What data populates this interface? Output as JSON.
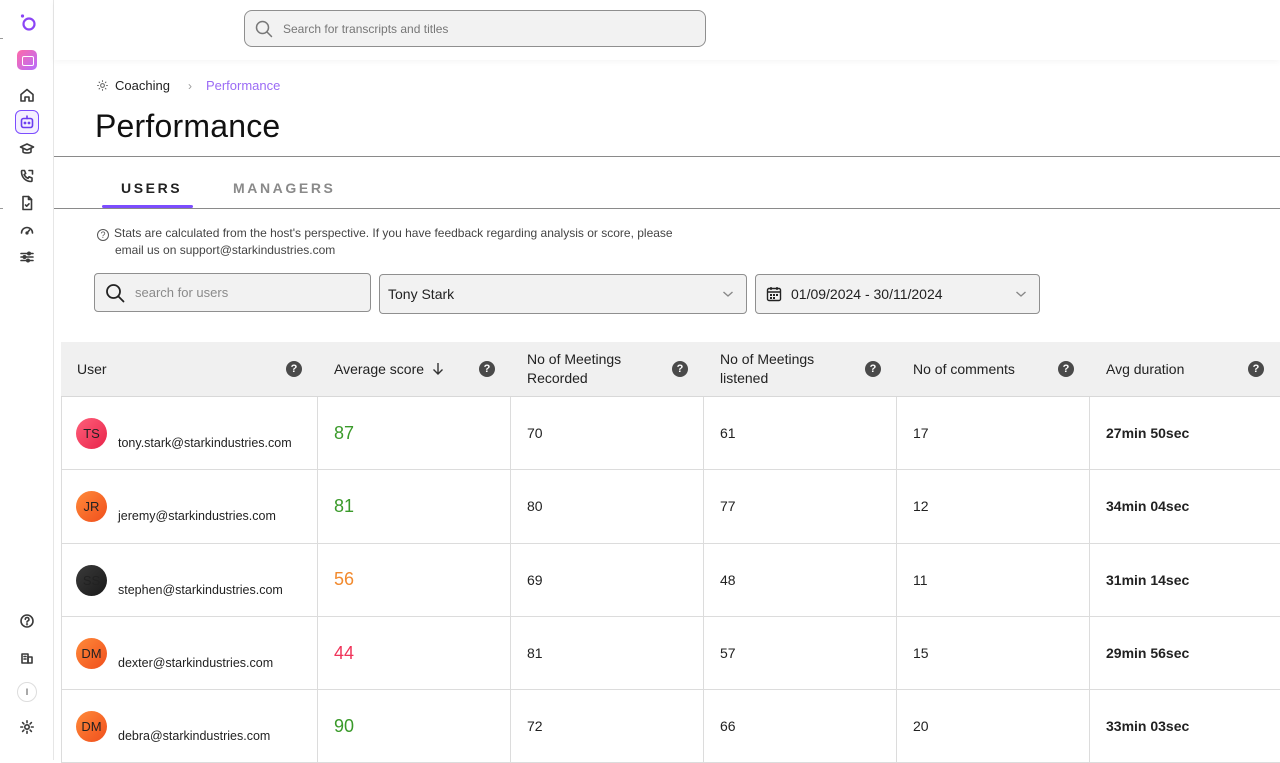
{
  "search": {
    "placeholder": "Search for transcripts and titles"
  },
  "breadcrumb": {
    "parent": "Coaching",
    "current": "Performance"
  },
  "page_title": "Performance",
  "tabs": [
    {
      "label": "USERS",
      "active": true
    },
    {
      "label": "MANAGERS",
      "active": false
    }
  ],
  "info": {
    "line1": "Stats are calculated from the host's perspective. If you have feedback regarding analysis or score, please",
    "line2": "email us on support@starkindustries.com"
  },
  "filters": {
    "user_search_placeholder": "search for users",
    "selected_user": "Tony Stark",
    "date_range": "01/09/2024 - 30/11/2024"
  },
  "table": {
    "headers": {
      "user": "User",
      "avg_score": "Average score",
      "meetings_recorded_1": "No of Meetings",
      "meetings_recorded_2": "Recorded",
      "meetings_listened_1": "No of Meetings",
      "meetings_listened_2": "listened",
      "comments": "No of comments",
      "avg_duration": "Avg duration"
    },
    "rows": [
      {
        "initials": "TS",
        "email": "tony.stark@starkindustries.com",
        "score": "87",
        "score_color": "#3a9a2a",
        "recorded": "70",
        "listened": "61",
        "comments": "17",
        "duration": "27min 50sec",
        "avatar": "linear-gradient(135deg,#ff5f7a,#e8244a)"
      },
      {
        "initials": "JR",
        "email": "jeremy@starkindustries.com",
        "score": "81",
        "score_color": "#3a9a2a",
        "recorded": "80",
        "listened": "77",
        "comments": "12",
        "duration": "34min 04sec",
        "avatar": "linear-gradient(135deg,#ff8a3a,#f04e1c)"
      },
      {
        "initials": "SS",
        "email": "stephen@starkindustries.com",
        "score": "56",
        "score_color": "#f28a2e",
        "recorded": "69",
        "listened": "48",
        "comments": "11",
        "duration": "31min 14sec",
        "avatar": "linear-gradient(135deg,#3a3a3a,#1a1a1a)"
      },
      {
        "initials": "DM",
        "email": "dexter@starkindustries.com",
        "score": "44",
        "score_color": "#f0345a",
        "recorded": "81",
        "listened": "57",
        "comments": "15",
        "duration": "29min 56sec",
        "avatar": "linear-gradient(135deg,#ff8a3a,#f04e1c)"
      },
      {
        "initials": "DM",
        "email": "debra@starkindustries.com",
        "score": "90",
        "score_color": "#3a9a2a",
        "recorded": "72",
        "listened": "66",
        "comments": "20",
        "duration": "33min 03sec",
        "avatar": "linear-gradient(135deg,#ff8a3a,#f04e1c)"
      }
    ]
  },
  "sidebar": {
    "icons": [
      "logo-icon",
      "app-icon",
      "home-icon",
      "coaching-icon",
      "learning-icon",
      "calls-icon",
      "documents-icon",
      "analytics-icon",
      "settings-sliders-icon",
      "help-icon",
      "company-icon",
      "user-icon",
      "gear-icon"
    ],
    "user_initial": "I"
  },
  "colors": {
    "accent": "#7c4dff",
    "breadcrumb_current": "#9b6bf5"
  }
}
